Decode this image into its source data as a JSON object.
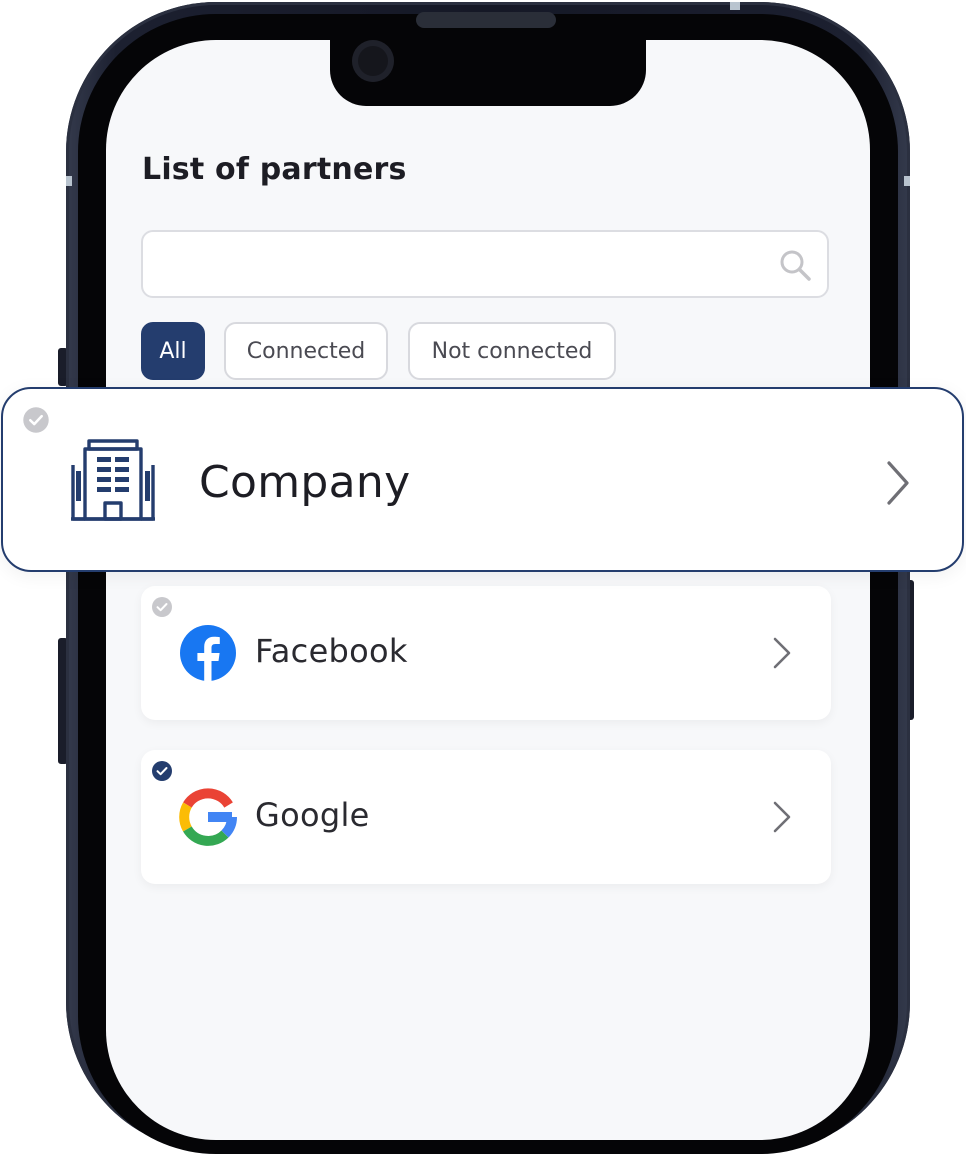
{
  "page": {
    "title": "List of partners"
  },
  "search": {
    "value": "",
    "icon": "search-icon"
  },
  "filters": {
    "all": "All",
    "connected": "Connected",
    "not_connected": "Not connected",
    "selected": "All"
  },
  "partners": [
    {
      "name": "Company",
      "icon": "building-icon",
      "connected": false,
      "highlighted": true
    },
    {
      "name": "Facebook",
      "icon": "facebook-logo-icon",
      "connected": false,
      "highlighted": false
    },
    {
      "name": "Google",
      "icon": "google-logo-icon",
      "connected": true,
      "highlighted": false
    }
  ],
  "colors": {
    "accent": "#243d6e",
    "connected_dot": "#243d6e",
    "not_connected_dot": "#c8c8cc",
    "screen_bg": "#f7f8fa",
    "facebook_blue": "#1877f2"
  }
}
